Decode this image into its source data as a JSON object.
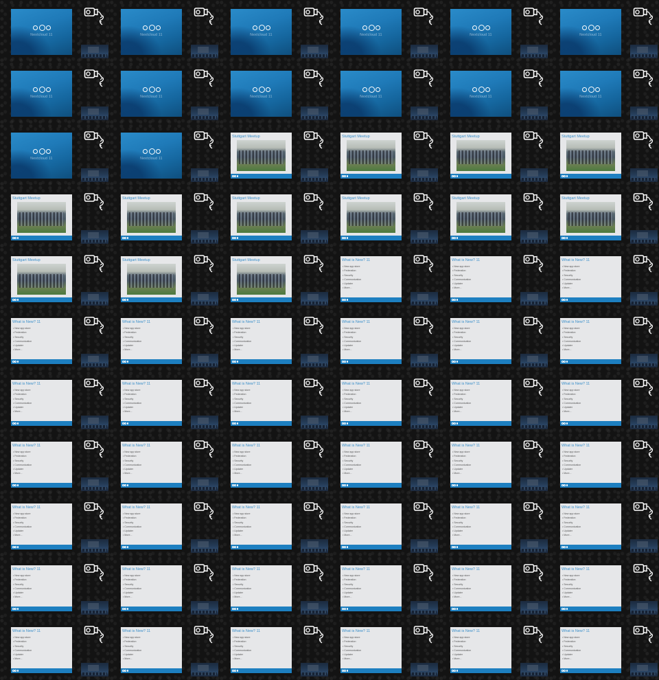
{
  "frames": [
    "title",
    "title",
    "title",
    "title",
    "title",
    "title",
    "title",
    "title",
    "title",
    "title",
    "title",
    "title",
    "title",
    "title",
    "photo",
    "photo",
    "photo",
    "photo",
    "photo",
    "photo",
    "photo",
    "photo",
    "photo",
    "photo",
    "photo",
    "photo",
    "photo",
    "list",
    "list",
    "list",
    "list",
    "list",
    "list",
    "list",
    "list",
    "list",
    "list",
    "list",
    "list",
    "list",
    "list",
    "list",
    "list",
    "list",
    "list",
    "list",
    "list",
    "list",
    "list",
    "list",
    "list",
    "list",
    "list",
    "list",
    "list",
    "list",
    "list",
    "list",
    "list",
    "list",
    "list",
    "list",
    "list",
    "list",
    "list",
    "list"
  ],
  "title_slide": {
    "brand": "Nextcloud 11"
  },
  "photo_slide": {
    "title": "Stuttgart Meetup"
  },
  "list_slide": {
    "title": "What is New? 11",
    "items": [
      "New app store",
      "Federation",
      "Security",
      "Communication",
      "Updater",
      "More..."
    ]
  },
  "colors": {
    "accent": "#1d7fc0",
    "title_blue": "#3a8fca",
    "background": "#101010",
    "slide_gray": "#e6e7e9"
  },
  "icons": {
    "slide_logo": "nextcloud-logo-icon",
    "side_icon": "camera-plug-icon"
  }
}
